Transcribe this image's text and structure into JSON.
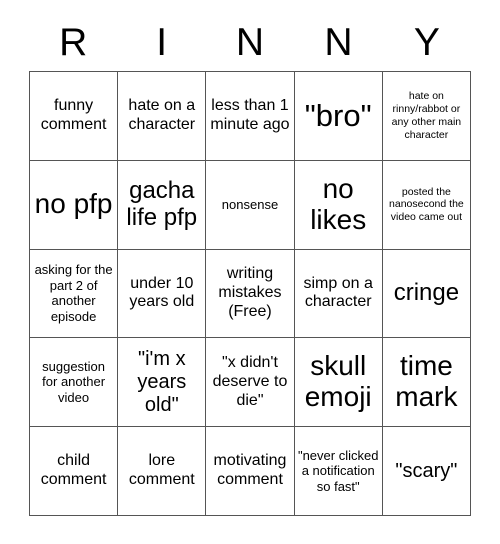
{
  "card": {
    "title_letters": [
      "R",
      "I",
      "N",
      "N",
      "Y"
    ],
    "columns": 5,
    "rows": 5,
    "background_color": "#ffffff",
    "text_color": "#000000",
    "grid_line_color": "#555555",
    "cells": [
      {
        "text": "funny comment",
        "size": "fs-md"
      },
      {
        "text": "hate on a character",
        "size": "fs-md"
      },
      {
        "text": "less than 1 minute ago",
        "size": "fs-md"
      },
      {
        "text": "\"bro\"",
        "size": "fs-huge"
      },
      {
        "text": "hate on rinny/rabbot or any other main character",
        "size": "fs-xs"
      },
      {
        "text": "no pfp",
        "size": "fs-xxl"
      },
      {
        "text": "gacha life pfp",
        "size": "fs-xl"
      },
      {
        "text": "nonsense",
        "size": "fs-sm"
      },
      {
        "text": "no likes",
        "size": "fs-xxl"
      },
      {
        "text": "posted the nanosecond the video came out",
        "size": "fs-xs"
      },
      {
        "text": "asking for the part 2 of another episode",
        "size": "fs-sm"
      },
      {
        "text": "under 10 years old",
        "size": "fs-md"
      },
      {
        "text": "writing mistakes (Free)",
        "size": "fs-md"
      },
      {
        "text": "simp on a character",
        "size": "fs-md"
      },
      {
        "text": "cringe",
        "size": "fs-xl"
      },
      {
        "text": "suggestion for another video",
        "size": "fs-sm"
      },
      {
        "text": "\"i'm x years old\"",
        "size": "fs-lg"
      },
      {
        "text": "\"x didn't deserve to die\"",
        "size": "fs-md"
      },
      {
        "text": "skull emoji",
        "size": "fs-xxl"
      },
      {
        "text": "time mark",
        "size": "fs-xxl"
      },
      {
        "text": "child comment",
        "size": "fs-md"
      },
      {
        "text": "lore comment",
        "size": "fs-md"
      },
      {
        "text": "motivating comment",
        "size": "fs-md"
      },
      {
        "text": "\"never clicked a notification so fast\"",
        "size": "fs-sm"
      },
      {
        "text": "\"scary\"",
        "size": "fs-lg"
      }
    ]
  }
}
